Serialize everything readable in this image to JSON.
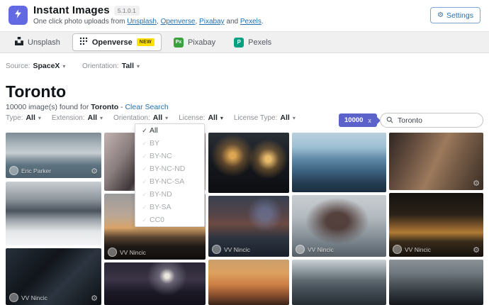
{
  "header": {
    "app_title": "Instant Images",
    "version": "5.1.0.1",
    "subtitle": {
      "prefix": "One click photo uploads from ",
      "links": [
        "Unsplash",
        "Openverse",
        "Pixabay",
        "Pexels"
      ],
      "sep": ", ",
      "and": " and ",
      "period": "."
    },
    "settings_label": "Settings"
  },
  "tabs": [
    {
      "label": "Unsplash",
      "active": false
    },
    {
      "label": "Openverse",
      "badge": "NEW",
      "active": true
    },
    {
      "label": "Pixabay",
      "active": false
    },
    {
      "label": "Pexels",
      "active": false
    }
  ],
  "controls": {
    "source_label": "Source:",
    "source_value": "SpaceX",
    "orientation_label": "Orientation:",
    "orientation_value": "Tall",
    "result_tag": "10000",
    "tag_close": "x",
    "search_value": "Toronto"
  },
  "results": {
    "title": "Toronto",
    "summary_prefix": "10000 image(s) found for ",
    "summary_term": "Toronto",
    "summary_sep": " - ",
    "clear_link": "Clear Search"
  },
  "filters": [
    {
      "label": "Type:",
      "value": "All"
    },
    {
      "label": "Extension:",
      "value": "All"
    },
    {
      "label": "Orientation:",
      "value": "All"
    },
    {
      "label": "License:",
      "value": "All"
    },
    {
      "label": "License Type:",
      "value": "All"
    }
  ],
  "license_dropdown": {
    "items": [
      {
        "label": "All",
        "checked": true
      },
      {
        "label": "BY",
        "checked": false
      },
      {
        "label": "BY-NC",
        "checked": false
      },
      {
        "label": "BY-NC-ND",
        "checked": false
      },
      {
        "label": "BY-NC-SA",
        "checked": false
      },
      {
        "label": "BY-ND",
        "checked": false
      },
      {
        "label": "BY-SA",
        "checked": false
      },
      {
        "label": "CC0",
        "checked": false
      }
    ]
  },
  "grid": {
    "tiles": [
      {
        "id": "c1t1",
        "desc": "toronto-skyline-from-lake",
        "author": "Eric Parker"
      },
      {
        "id": "c1t2",
        "desc": "snowy-street-with-church",
        "author": ""
      },
      {
        "id": "c1t3",
        "desc": "dark-building-wall-night",
        "author": "VV Nincic"
      },
      {
        "id": "c2t1",
        "desc": "concrete-stairs-diagonal",
        "author": ""
      },
      {
        "id": "c2t2",
        "desc": "sunset-skyline-with-spire",
        "author": "VV Nincic"
      },
      {
        "id": "c2t3",
        "desc": "moonlit-city-night",
        "author": ""
      },
      {
        "id": "c3t1",
        "desc": "night-wall-lights-garden",
        "author": ""
      },
      {
        "id": "c3t2",
        "desc": "dusk-neighborhood-rooftops",
        "author": "VV Nincic"
      },
      {
        "id": "c3t3",
        "desc": "orange-sunset-sky",
        "author": ""
      },
      {
        "id": "c4t1",
        "desc": "blue-glass-towers-day",
        "author": ""
      },
      {
        "id": "c4t2",
        "desc": "foggy-tower-in-snow",
        "author": "VV Nincic"
      },
      {
        "id": "c4t3",
        "desc": "apartment-rooftop-people",
        "author": ""
      },
      {
        "id": "c5t1",
        "desc": "alley-with-bicycles",
        "author": ""
      },
      {
        "id": "c5t2",
        "desc": "dark-amber-city-sunset",
        "author": "VV Nincic"
      },
      {
        "id": "c5t3",
        "desc": "stormy-grey-skyline",
        "author": ""
      }
    ]
  },
  "glyphs": {
    "caret": "▾",
    "check": "✓",
    "gear": "⚙",
    "px_icon": "Px",
    "pexels_icon": "P"
  },
  "colors": {
    "accent": "#5b63cb",
    "logo": "#6269e2",
    "wp_link": "#2271b1",
    "new_badge": "#ffe000",
    "pixabay_green": "#3aa13f",
    "pexels_green": "#05a081"
  }
}
